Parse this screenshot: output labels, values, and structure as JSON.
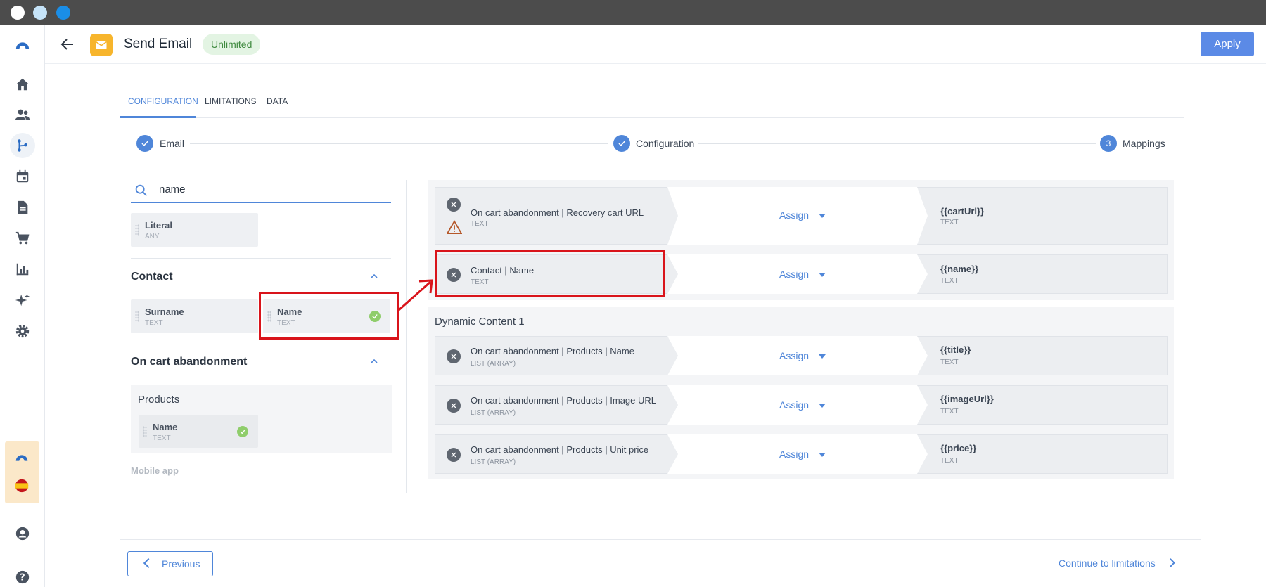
{
  "header": {
    "title": "Send Email",
    "badge": "Unlimited",
    "apply_label": "Apply"
  },
  "tabs": [
    {
      "label": "CONFIGURATION",
      "active": true
    },
    {
      "label": "LIMITATIONS",
      "active": false
    },
    {
      "label": "DATA",
      "active": false
    }
  ],
  "stepper": [
    {
      "label": "Email",
      "state": "done"
    },
    {
      "label": "Configuration",
      "state": "done"
    },
    {
      "label": "Mappings",
      "state": "current",
      "number": "3"
    }
  ],
  "search": {
    "value": "name"
  },
  "literal": {
    "name": "Literal",
    "type": "ANY"
  },
  "contact": {
    "title": "Contact",
    "items": [
      {
        "name": "Surname",
        "type": "TEXT"
      },
      {
        "name": "Name",
        "type": "TEXT"
      }
    ]
  },
  "cart": {
    "title": "On cart abandonment",
    "group": "Products",
    "items": [
      {
        "name": "Name",
        "type": "TEXT"
      }
    ]
  },
  "mobile_app": "Mobile app",
  "mappings": [
    {
      "source": "On cart abandonment | Recovery cart URL",
      "source_type": "TEXT",
      "action": "Assign",
      "target": "{{cartUrl}}",
      "target_type": "TEXT",
      "warning": true
    },
    {
      "source": "Contact | Name",
      "source_type": "TEXT",
      "action": "Assign",
      "target": "{{name}}",
      "target_type": "TEXT"
    }
  ],
  "dynamic_content": {
    "title": "Dynamic Content 1",
    "mappings": [
      {
        "source": "On cart abandonment | Products | Name",
        "source_type": "LIST (ARRAY)",
        "action": "Assign",
        "target": "{{title}}",
        "target_type": "TEXT"
      },
      {
        "source": "On cart abandonment | Products | Image URL",
        "source_type": "LIST (ARRAY)",
        "action": "Assign",
        "target": "{{imageUrl}}",
        "target_type": "TEXT"
      },
      {
        "source": "On cart abandonment | Products | Unit price",
        "source_type": "LIST (ARRAY)",
        "action": "Assign",
        "target": "{{price}}",
        "target_type": "TEXT"
      }
    ]
  },
  "footer": {
    "previous_label": "Previous",
    "continue_label": "Continue to limitations"
  },
  "colors": {
    "accent": "#4f86d9",
    "apply": "#5b8ae6",
    "app_icon": "#f7b52c",
    "highlight": "#d9141b",
    "check": "#8fcd6b"
  }
}
